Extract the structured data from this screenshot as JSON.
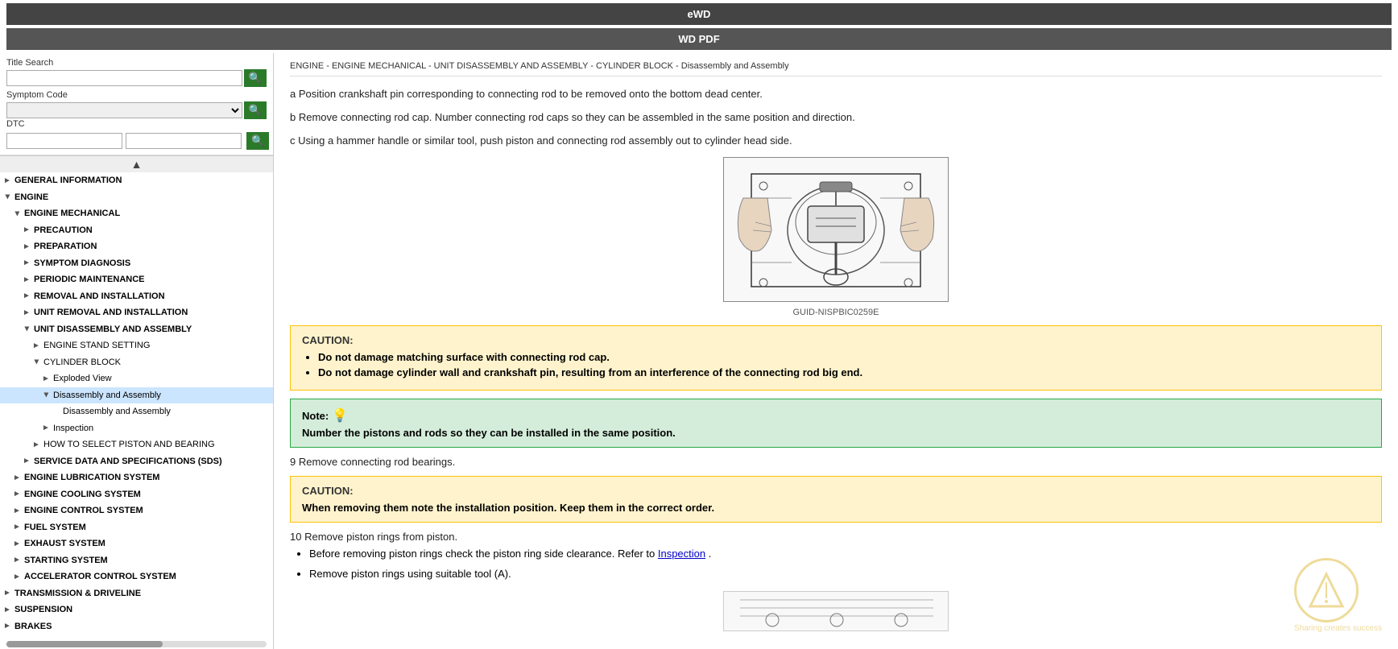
{
  "topbar": {
    "ewd_label": "eWD",
    "wdpdf_label": "WD PDF"
  },
  "sidebar": {
    "title_search_label": "Title Search",
    "symptom_code_label": "Symptom Code",
    "dtc_label": "DTC",
    "search_placeholder": "",
    "tree": [
      {
        "id": "general-info",
        "label": "GENERAL INFORMATION",
        "indent": 0,
        "arrow": "►",
        "open": false
      },
      {
        "id": "engine",
        "label": "ENGINE",
        "indent": 0,
        "arrow": "►",
        "open": true
      },
      {
        "id": "engine-mechanical",
        "label": "ENGINE MECHANICAL",
        "indent": 1,
        "arrow": "▼",
        "open": true
      },
      {
        "id": "precaution",
        "label": "PRECAUTION",
        "indent": 2,
        "arrow": "►",
        "open": false
      },
      {
        "id": "preparation",
        "label": "PREPARATION",
        "indent": 2,
        "arrow": "►",
        "open": false
      },
      {
        "id": "symptom-diagnosis",
        "label": "SYMPTOM DIAGNOSIS",
        "indent": 2,
        "arrow": "►",
        "open": false
      },
      {
        "id": "periodic-maintenance",
        "label": "PERIODIC MAINTENANCE",
        "indent": 2,
        "arrow": "►",
        "open": false
      },
      {
        "id": "removal-installation",
        "label": "REMOVAL AND INSTALLATION",
        "indent": 2,
        "arrow": "►",
        "open": false
      },
      {
        "id": "unit-removal-installation",
        "label": "UNIT REMOVAL AND INSTALLATION",
        "indent": 2,
        "arrow": "►",
        "open": false
      },
      {
        "id": "unit-disassembly-assembly",
        "label": "UNIT DISASSEMBLY AND ASSEMBLY",
        "indent": 2,
        "arrow": "▼",
        "open": true
      },
      {
        "id": "engine-stand-setting",
        "label": "ENGINE STAND SETTING",
        "indent": 3,
        "arrow": "►",
        "open": false
      },
      {
        "id": "cylinder-block",
        "label": "CYLINDER BLOCK",
        "indent": 3,
        "arrow": "▼",
        "open": true
      },
      {
        "id": "exploded-view",
        "label": "Exploded View",
        "indent": 4,
        "arrow": "►",
        "open": false
      },
      {
        "id": "disassembly-assembly",
        "label": "Disassembly and Assembly",
        "indent": 4,
        "arrow": "▼",
        "open": true,
        "selected": true
      },
      {
        "id": "disassembly-assembly-sub",
        "label": "Disassembly and Assembly",
        "indent": 5,
        "arrow": "",
        "open": false
      },
      {
        "id": "inspection",
        "label": "Inspection",
        "indent": 4,
        "arrow": "►",
        "open": false
      },
      {
        "id": "how-to-select",
        "label": "HOW TO SELECT PISTON AND BEARING",
        "indent": 3,
        "arrow": "►",
        "open": false
      },
      {
        "id": "service-data",
        "label": "SERVICE DATA AND SPECIFICATIONS (SDS)",
        "indent": 2,
        "arrow": "►",
        "open": false
      },
      {
        "id": "engine-lubrication",
        "label": "ENGINE LUBRICATION SYSTEM",
        "indent": 1,
        "arrow": "►",
        "open": false
      },
      {
        "id": "engine-cooling",
        "label": "ENGINE COOLING SYSTEM",
        "indent": 1,
        "arrow": "►",
        "open": false
      },
      {
        "id": "engine-control",
        "label": "ENGINE CONTROL SYSTEM",
        "indent": 1,
        "arrow": "►",
        "open": false
      },
      {
        "id": "fuel-system",
        "label": "FUEL SYSTEM",
        "indent": 1,
        "arrow": "►",
        "open": false
      },
      {
        "id": "exhaust-system",
        "label": "EXHAUST SYSTEM",
        "indent": 1,
        "arrow": "►",
        "open": false
      },
      {
        "id": "starting-system",
        "label": "STARTING SYSTEM",
        "indent": 1,
        "arrow": "►",
        "open": false
      },
      {
        "id": "accelerator-control",
        "label": "ACCELERATOR CONTROL SYSTEM",
        "indent": 1,
        "arrow": "►",
        "open": false
      },
      {
        "id": "transmission",
        "label": "TRANSMISSION & DRIVELINE",
        "indent": 0,
        "arrow": "►",
        "open": false
      },
      {
        "id": "suspension",
        "label": "SUSPENSION",
        "indent": 0,
        "arrow": "►",
        "open": false
      },
      {
        "id": "brakes",
        "label": "BRAKES",
        "indent": 0,
        "arrow": "►",
        "open": false
      }
    ]
  },
  "content": {
    "breadcrumb": "ENGINE - ENGINE MECHANICAL - UNIT DISASSEMBLY AND ASSEMBLY - CYLINDER BLOCK - Disassembly and Assembly",
    "para_a": "a Position crankshaft pin corresponding to connecting rod to be removed onto the bottom dead center.",
    "para_b": "b Remove connecting rod cap. Number connecting rod caps so they can be assembled in the same position and direction.",
    "para_c": "c Using a hammer handle or similar tool, push piston and connecting rod assembly out to cylinder head side.",
    "figure_caption": "GUID-NISPBIC0259E",
    "caution1_title": "CAUTION:",
    "caution1_items": [
      "Do not damage matching surface with connecting rod cap.",
      "Do not damage cylinder wall and crankshaft pin, resulting from an interference of the connecting rod big end."
    ],
    "note_title": "Note:",
    "note_text": "Number the pistons and rods so they can be installed in the same position.",
    "step9": "9 Remove connecting rod bearings.",
    "caution2_title": "CAUTION:",
    "caution2_text": "When removing them note the installation position. Keep them in the correct order.",
    "step10": "10 Remove piston rings from piston.",
    "bullet1": "Before removing piston rings check the piston ring side clearance. Refer to",
    "bullet1_link": "Inspection",
    "bullet1_end": ".",
    "bullet2": "Remove piston rings using suitable tool (A)."
  },
  "watermark": {
    "sharing_text": "Sharing creates success"
  }
}
